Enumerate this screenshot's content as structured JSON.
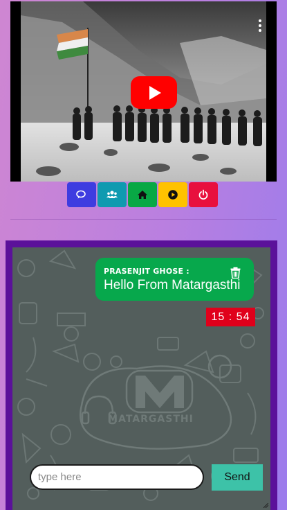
{
  "video": {
    "play_icon": "play-icon",
    "menu_icon": "kebab-menu-icon",
    "thumbnail": "soldiers-with-flag-in-snow"
  },
  "nav_buttons": [
    {
      "icon": "comments-icon",
      "color": "#3e3ce0"
    },
    {
      "icon": "users-icon",
      "color": "#0f9ab0"
    },
    {
      "icon": "home-icon",
      "color": "#08a845"
    },
    {
      "icon": "play-circle-icon",
      "color": "#ffc200"
    },
    {
      "icon": "power-icon",
      "color": "#e8103e"
    }
  ],
  "chat": {
    "message": {
      "sender": "PRASENJIT GHOSE :",
      "text": "Hello From Matargasthi",
      "delete_icon": "trash-icon",
      "bubble_color": "#07a84c"
    },
    "time": "15 : 54",
    "time_color": "#e0001b",
    "input_placeholder": "type here",
    "send_label": "Send",
    "background_logo_text": "MATARGASTHI"
  },
  "colors": {
    "chat_frame": "#5b119a",
    "chat_background": "#535e5c",
    "send_button": "#3dc2a8"
  }
}
